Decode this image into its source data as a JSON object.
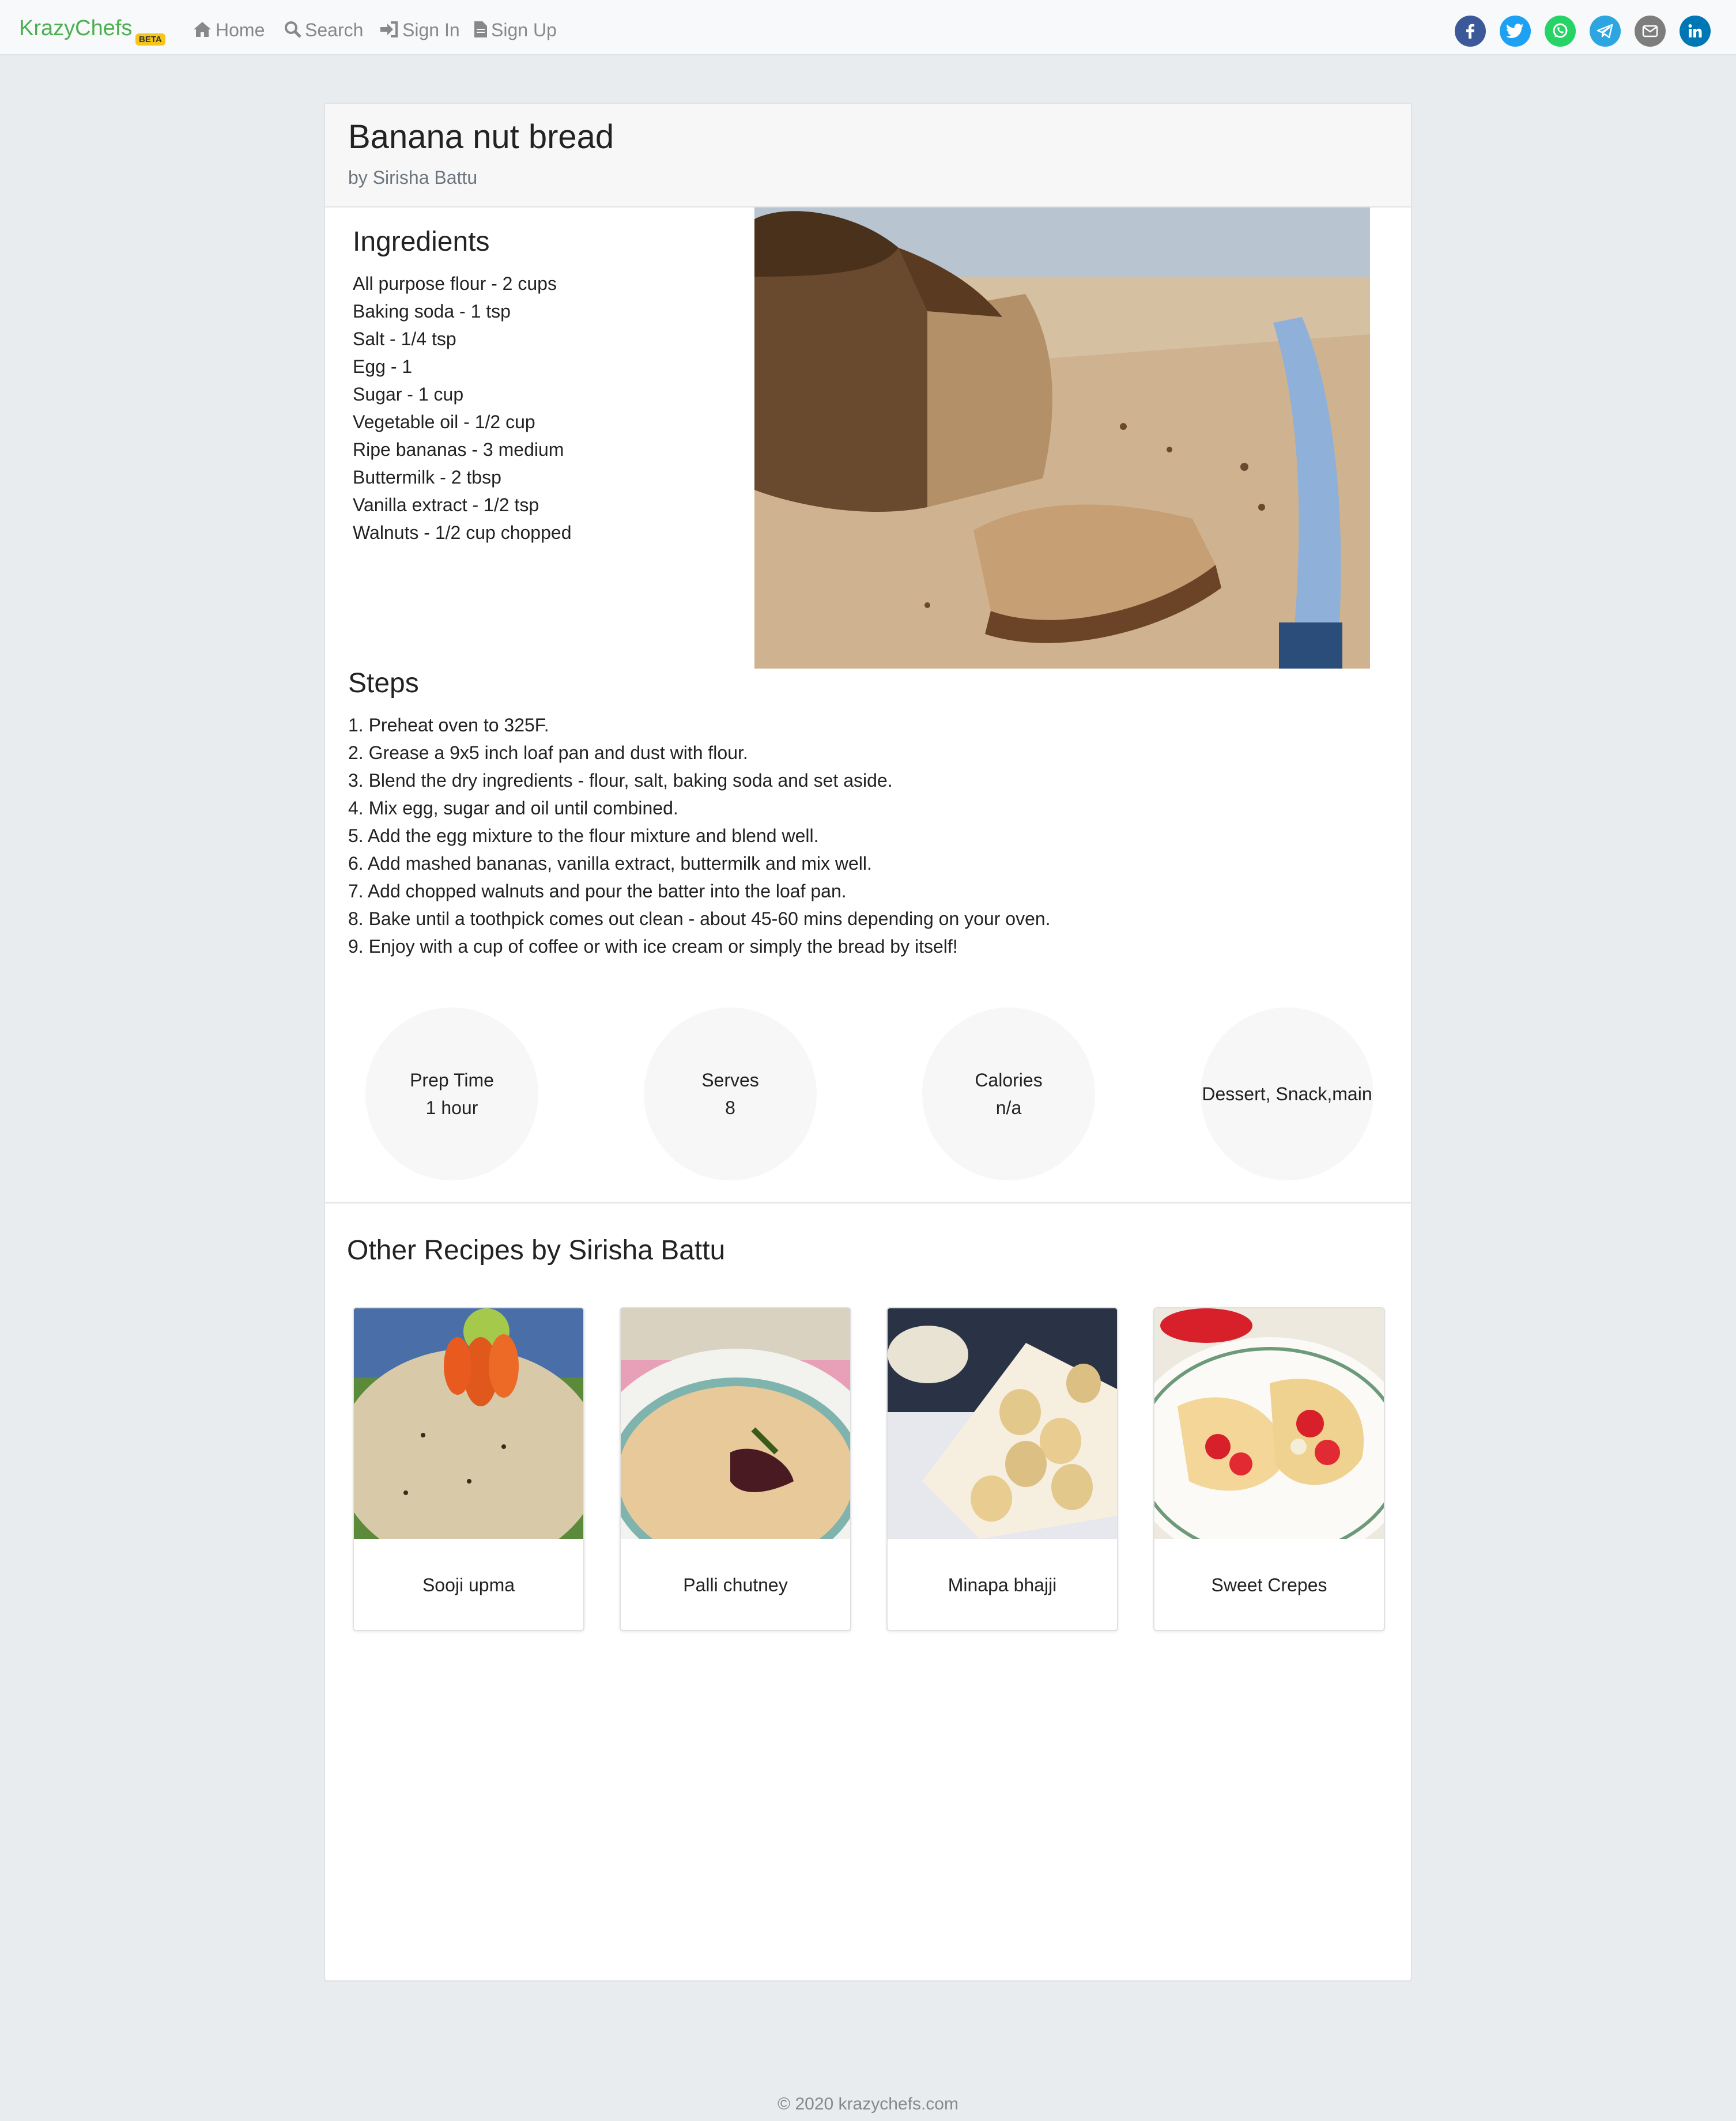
{
  "nav": {
    "brand": "KrazyChefs",
    "badge": "BETA",
    "links": [
      {
        "label": "Home",
        "icon": "home-icon"
      },
      {
        "label": "Search",
        "icon": "search-icon"
      },
      {
        "label": "Sign In",
        "icon": "sign-in-icon"
      },
      {
        "label": "Sign Up",
        "icon": "document-icon"
      }
    ],
    "share": [
      {
        "icon": "facebook-icon",
        "color": "#3b5998"
      },
      {
        "icon": "twitter-icon",
        "color": "#1da1f2"
      },
      {
        "icon": "whatsapp-icon",
        "color": "#25d366"
      },
      {
        "icon": "telegram-icon",
        "color": "#2ca5e0"
      },
      {
        "icon": "email-icon",
        "color": "#7d7d7d"
      },
      {
        "icon": "linkedin-icon",
        "color": "#0077b5"
      }
    ]
  },
  "recipe": {
    "title": "Banana nut bread",
    "author": "by Sirisha Battu",
    "ingredients_heading": "Ingredients",
    "ingredients": [
      "All purpose flour - 2 cups",
      "Baking soda - 1 tsp",
      "Salt - 1/4 tsp",
      "Egg - 1",
      "Sugar - 1 cup",
      "Vegetable oil - 1/2 cup",
      "Ripe bananas - 3 medium",
      "Buttermilk - 2 tbsp",
      "Vanilla extract - 1/2 tsp",
      "Walnuts - 1/2 cup chopped"
    ],
    "steps_heading": "Steps",
    "steps": [
      "1. Preheat oven to 325F.",
      "2. Grease a 9x5 inch loaf pan and dust with flour.",
      "3. Blend the dry ingredients - flour, salt, baking soda and set aside.",
      "4. Mix egg, sugar and oil until combined.",
      "5. Add the egg mixture to the flour mixture and blend well.",
      "6. Add mashed bananas, vanilla extract, buttermilk and mix well.",
      "7. Add chopped walnuts and pour the batter into the loaf pan.",
      "8. Bake until a toothpick comes out clean - about 45-60 mins depending on your oven.",
      "9. Enjoy with a cup of coffee or with ice cream or simply the bread by itself!"
    ],
    "stats": {
      "prep_label": "Prep Time",
      "prep_value": "1 hour",
      "serves_label": "Serves",
      "serves_value": "8",
      "calories_label": "Calories",
      "calories_value": "n/a",
      "category": "Dessert, Snack,main"
    }
  },
  "other": {
    "heading": "Other Recipes by Sirisha Battu",
    "recipes": [
      {
        "name": "Sooji upma"
      },
      {
        "name": "Palli chutney"
      },
      {
        "name": "Minapa bhajji"
      },
      {
        "name": "Sweet Crepes"
      }
    ]
  },
  "footer": "© 2020 krazychefs.com"
}
